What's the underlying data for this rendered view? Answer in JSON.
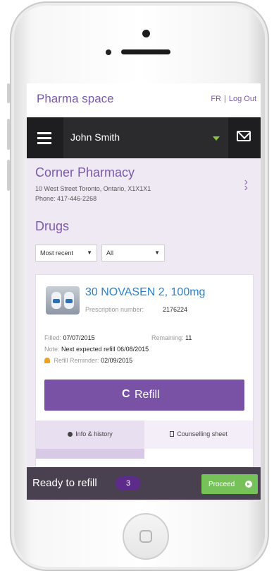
{
  "app": {
    "title": "Pharma space",
    "lang_link": "FR",
    "logout_link": "Log Out"
  },
  "user": {
    "name": "John Smith"
  },
  "pharmacy": {
    "name": "Corner Pharmacy",
    "address": "10 West Street Toronto, Ontario, X1X1X1",
    "phone": "Phone: 417-446-2268"
  },
  "drugs": {
    "title": "Drugs",
    "sort_select": "Most recent",
    "filter_select": "All",
    "card": {
      "name": "30 NOVASEN 2, 100mg",
      "rx_label": "Prescription number:",
      "rx_number": "2176224",
      "filled_label": "Filled:",
      "filled_value": "07/07/2015",
      "remaining_label": "Remaining:",
      "remaining_value": "11",
      "note_label": "Note:",
      "note_value": "Next expected refill 06/08/2015",
      "reminder_label": "Refill Reminder:",
      "reminder_value": "02/09/2015",
      "refill_button": "Refill",
      "refill_icon": "C",
      "tab_info": "Info & history",
      "tab_counselling": "Counselling sheet"
    }
  },
  "ready_bar": {
    "label": "Ready to refill",
    "count": "3",
    "proceed_button": "Proceed"
  },
  "colors": {
    "accent": "#7a52a5",
    "link": "#2f80c7",
    "proceed": "#76c15a",
    "dark": "#2b2a2c"
  }
}
